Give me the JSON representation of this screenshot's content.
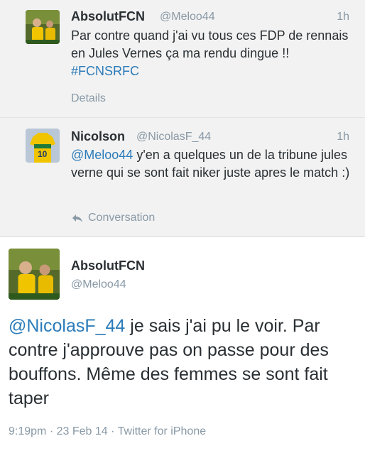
{
  "tweets": [
    {
      "name": "AbsolutFCN",
      "handle": "@Meloo44",
      "time": "1h",
      "text_before": "Par contre quand j'ai vu tous ces FDP de rennais en Jules Vernes ça ma rendu dingue !! ",
      "hashtag": "#FCNSRFC",
      "action": "Details"
    },
    {
      "name": "Nicolson",
      "handle": "@NicolasF_44",
      "time": "1h",
      "mention": "@Meloo44",
      "text_after": " y'en a quelques un de la tribune jules verne qui se sont fait niker juste apres le match :)",
      "action": "Conversation"
    }
  ],
  "focus": {
    "name": "AbsolutFCN",
    "handle": "@Meloo44",
    "mention": "@NicolasF_44",
    "text_after": " je sais j'ai pu le voir. Par contre j'approuve pas on passe pour des bouffons. Même des femmes se sont fait taper",
    "time": "9:19pm",
    "date": "23 Feb 14",
    "source": "Twitter for iPhone",
    "separator": "·"
  },
  "colors": {
    "link": "#2b7bb9",
    "muted": "#8899a6",
    "text": "#292f33",
    "gray_bg": "#f2f2f2",
    "jersey_yellow": "#f1c400",
    "jersey_green": "#1f7a3a"
  },
  "icons": [
    "reply-icon"
  ]
}
